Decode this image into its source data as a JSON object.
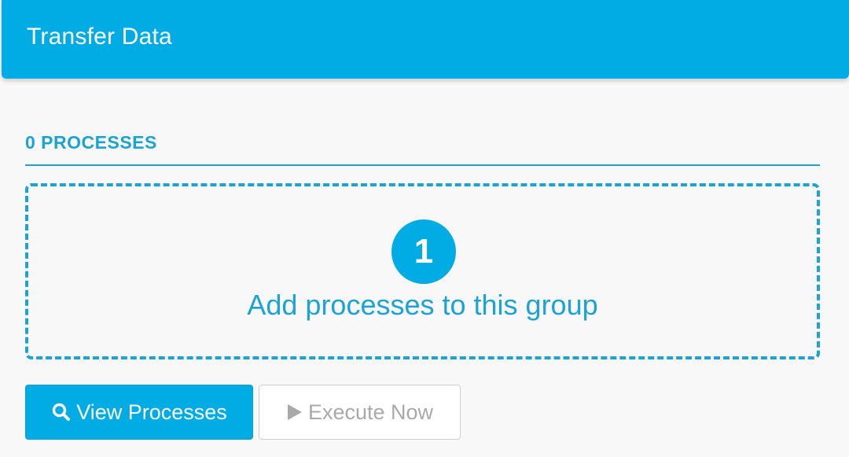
{
  "header": {
    "title": "Transfer Data"
  },
  "section": {
    "label": "0 PROCESSES"
  },
  "dropzone": {
    "step_number": "1",
    "text": "Add processes to this group"
  },
  "actions": {
    "view_label": "View Processes",
    "view_icon": "search-icon",
    "execute_label": "Execute Now",
    "execute_icon": "play-icon"
  },
  "colors": {
    "accent": "#00ace3",
    "accent_text": "#1aa3d4",
    "disabled_text": "#a9a9a9",
    "background": "#f8f8f8"
  }
}
